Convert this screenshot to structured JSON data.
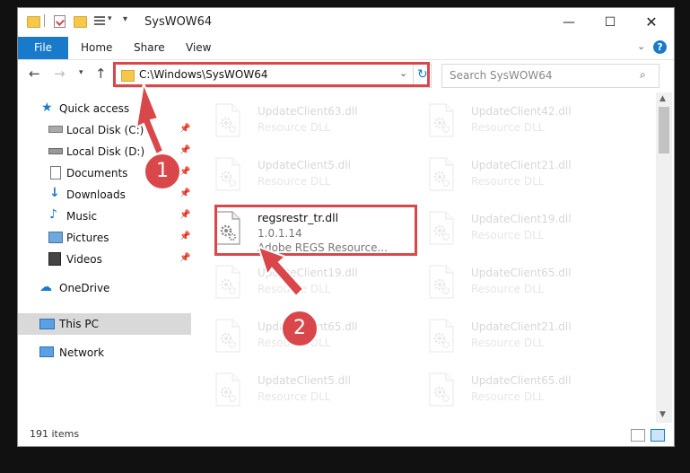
{
  "window": {
    "title": "SysWOW64"
  },
  "ribbon": {
    "file": "File",
    "home": "Home",
    "share": "Share",
    "view": "View"
  },
  "address": {
    "path": "C:\\Windows\\SysWOW64"
  },
  "search": {
    "placeholder": "Search SysWOW64"
  },
  "sidebar": {
    "quick_access": "Quick access",
    "items": [
      {
        "label": "Local Disk (C:)"
      },
      {
        "label": "Local Disk (D:)"
      },
      {
        "label": "Documents"
      },
      {
        "label": "Downloads"
      },
      {
        "label": "Music"
      },
      {
        "label": "Pictures"
      },
      {
        "label": "Videos"
      }
    ],
    "onedrive": "OneDrive",
    "this_pc": "This PC",
    "network": "Network"
  },
  "files": {
    "left": [
      {
        "name": "UpdateClient63.dll",
        "desc": "Resource DLL"
      },
      {
        "name": "UpdateClient5.dll",
        "desc": "Resource DLL"
      },
      {
        "name": "UpdateClient19.dll",
        "desc": "Resource DLL"
      },
      {
        "name": "UpdateClient65.dll",
        "desc": "Resource DLL"
      },
      {
        "name": "UpdateClient5.dll",
        "desc": "Resource DLL"
      }
    ],
    "right": [
      {
        "name": "UpdateClient42.dll",
        "desc": "Resource DLL"
      },
      {
        "name": "UpdateClient21.dll",
        "desc": "Resource DLL"
      },
      {
        "name": "UpdateClient19.dll",
        "desc": "Resource DLL"
      },
      {
        "name": "UpdateClient65.dll",
        "desc": "Resource DLL"
      },
      {
        "name": "UpdateClient21.dll",
        "desc": "Resource DLL"
      },
      {
        "name": "UpdateClient65.dll",
        "desc": "Resource DLL"
      }
    ],
    "highlighted": {
      "name": "regsrestr_tr.dll",
      "version": "1.0.1.14",
      "desc": "Adobe REGS Resource..."
    }
  },
  "status": {
    "count": "191 items"
  },
  "callouts": {
    "first": "1",
    "second": "2"
  },
  "colors": {
    "accent": "#1979ca",
    "highlight": "#d9474b"
  }
}
